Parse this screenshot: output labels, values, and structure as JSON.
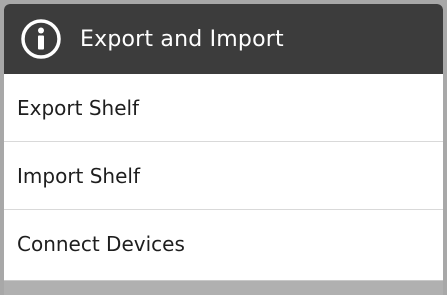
{
  "dialog": {
    "title": "Export and Import",
    "title_icon": "info-icon",
    "items": [
      {
        "label": "Export Shelf"
      },
      {
        "label": "Import Shelf"
      },
      {
        "label": "Connect Devices"
      }
    ]
  },
  "colors": {
    "titlebar_bg": "#3c3c3c",
    "list_bg": "#ffffff",
    "divider": "#d9d9d9",
    "backdrop": "#a8a8a8"
  }
}
